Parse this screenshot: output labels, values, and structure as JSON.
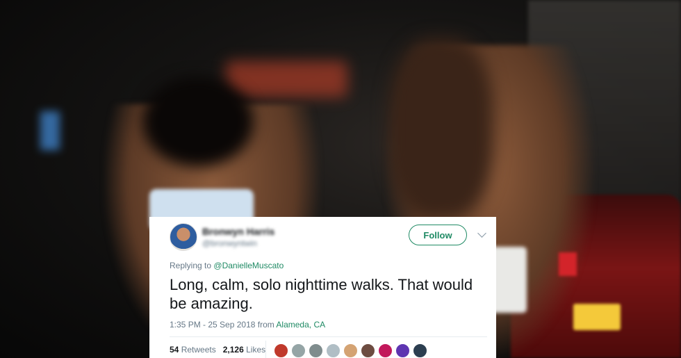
{
  "tweet": {
    "author_name": "Bronwyn Harris",
    "author_handle": "@bronwyntwin",
    "follow_label": "Follow",
    "replying_prefix": "Replying to",
    "replying_to": "@DanielleMuscato",
    "text": "Long, calm, solo nighttime walks. That would be amazing.",
    "timestamp": "1:35 PM - 25 Sep 2018 from",
    "location": "Alameda, CA",
    "retweets_count": "54",
    "retweets_label": "Retweets",
    "likes_count": "2,126",
    "likes_label": "Likes",
    "liker_colors": [
      "#c0392b",
      "#95a5a6",
      "#7f8c8d",
      "#b0bec5",
      "#d4a373",
      "#6d4c41",
      "#c2185b",
      "#5e35b1",
      "#2c3e50"
    ]
  },
  "colors": {
    "accent": "#1f8a64",
    "muted_text": "#657786",
    "body_text": "#14171a"
  }
}
